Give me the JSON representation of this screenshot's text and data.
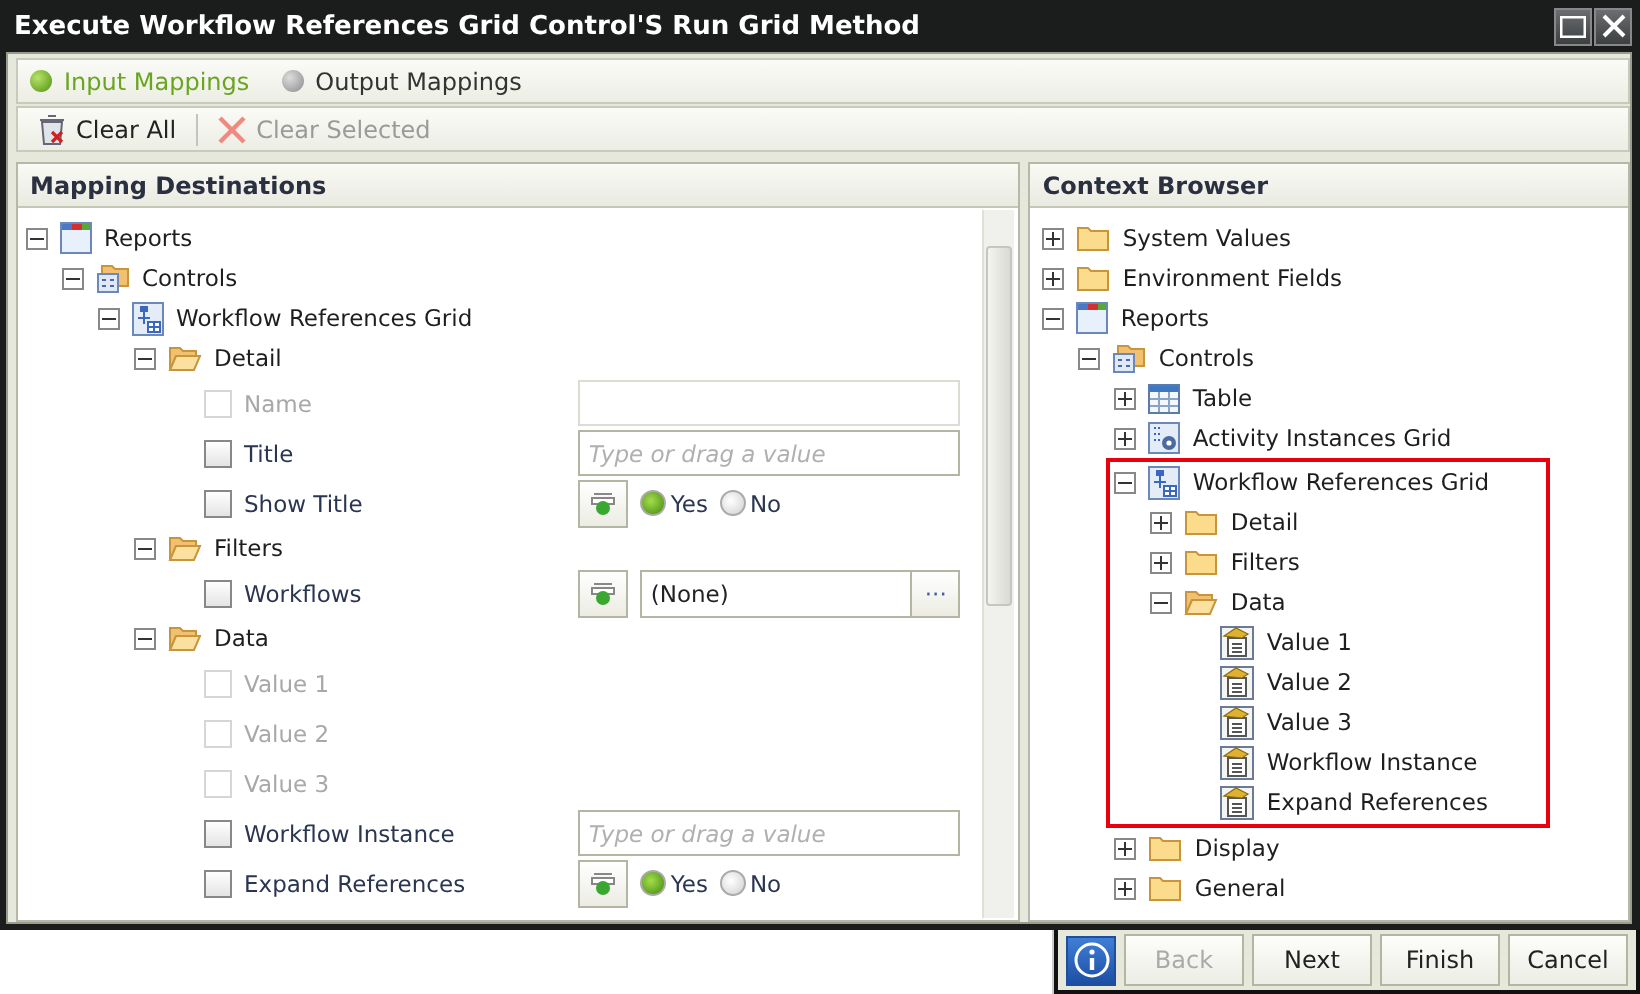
{
  "window": {
    "title": "Execute Workflow References Grid Control'S Run Grid Method"
  },
  "tabs": [
    {
      "label": "Input Mappings",
      "selected": true
    },
    {
      "label": "Output Mappings",
      "selected": false
    }
  ],
  "toolbar": [
    {
      "kind": "clear-all",
      "label": "Clear All",
      "disabled": false
    },
    {
      "kind": "clear-selected",
      "label": "Clear Selected",
      "disabled": true
    }
  ],
  "mapping_destinations": {
    "title": "Mapping Destinations",
    "tree": [
      {
        "label": "Reports",
        "kind": "report",
        "expanded": true,
        "children": [
          {
            "label": "Controls",
            "kind": "controls",
            "expanded": true,
            "children": [
              {
                "label": "Workflow References Grid",
                "kind": "grid",
                "expanded": true,
                "children": [
                  {
                    "label": "Detail",
                    "kind": "folder-open",
                    "expanded": true,
                    "fields": [
                      {
                        "label": "Name",
                        "disabled": true,
                        "checked": false,
                        "input": {
                          "kind": "text"
                        }
                      },
                      {
                        "label": "Title",
                        "disabled": false,
                        "checked": false,
                        "input": {
                          "kind": "text",
                          "placeholder": "Type or drag a value"
                        }
                      },
                      {
                        "label": "Show Title",
                        "disabled": false,
                        "checked": false,
                        "input": {
                          "kind": "boolean",
                          "options": [
                            {
                              "label": "Yes",
                              "selected": true
                            },
                            {
                              "label": "No",
                              "selected": false
                            }
                          ]
                        }
                      }
                    ]
                  },
                  {
                    "label": "Filters",
                    "kind": "folder-open",
                    "expanded": true,
                    "fields": [
                      {
                        "label": "Workflows",
                        "disabled": false,
                        "checked": false,
                        "input": {
                          "kind": "select",
                          "value": "(None)",
                          "button": "···"
                        }
                      }
                    ]
                  },
                  {
                    "label": "Data",
                    "kind": "folder-open",
                    "expanded": true,
                    "fields": [
                      {
                        "label": "Value 1",
                        "disabled": true,
                        "checked": false
                      },
                      {
                        "label": "Value 2",
                        "disabled": true,
                        "checked": false
                      },
                      {
                        "label": "Value 3",
                        "disabled": true,
                        "checked": false
                      },
                      {
                        "label": "Workflow Instance",
                        "disabled": false,
                        "checked": false,
                        "input": {
                          "kind": "text",
                          "placeholder": "Type or drag a value"
                        }
                      },
                      {
                        "label": "Expand References",
                        "disabled": false,
                        "checked": false,
                        "input": {
                          "kind": "boolean",
                          "options": [
                            {
                              "label": "Yes",
                              "selected": true
                            },
                            {
                              "label": "No",
                              "selected": false
                            }
                          ]
                        }
                      }
                    ]
                  }
                ]
              }
            ]
          }
        ]
      }
    ]
  },
  "context_browser": {
    "title": "Context Browser",
    "tree": [
      {
        "label": "System Values",
        "kind": "folder",
        "expanded": false
      },
      {
        "label": "Environment Fields",
        "kind": "folder",
        "expanded": false
      },
      {
        "label": "Reports",
        "kind": "report",
        "expanded": true,
        "children": [
          {
            "label": "Controls",
            "kind": "controls",
            "expanded": true,
            "children": [
              {
                "label": "Table",
                "kind": "table",
                "expanded": false
              },
              {
                "label": "Activity Instances Grid",
                "kind": "activity-grid",
                "expanded": false
              },
              {
                "label": "Workflow References Grid",
                "kind": "grid",
                "expanded": true,
                "highlighted": true,
                "children": [
                  {
                    "label": "Detail",
                    "kind": "folder",
                    "expanded": false
                  },
                  {
                    "label": "Filters",
                    "kind": "folder",
                    "expanded": false
                  },
                  {
                    "label": "Data",
                    "kind": "folder-open",
                    "expanded": true,
                    "children": [
                      {
                        "label": "Value 1",
                        "kind": "field"
                      },
                      {
                        "label": "Value 2",
                        "kind": "field"
                      },
                      {
                        "label": "Value 3",
                        "kind": "field"
                      },
                      {
                        "label": "Workflow Instance",
                        "kind": "field"
                      },
                      {
                        "label": "Expand References",
                        "kind": "field"
                      }
                    ]
                  }
                ]
              },
              {
                "label": "Display",
                "kind": "folder",
                "expanded": false
              },
              {
                "label": "General",
                "kind": "folder",
                "expanded": false
              }
            ]
          }
        ]
      }
    ]
  },
  "footer": [
    {
      "label": "Back",
      "disabled": true
    },
    {
      "label": "Next",
      "disabled": false
    },
    {
      "label": "Finish",
      "disabled": false
    },
    {
      "label": "Cancel",
      "disabled": false
    }
  ]
}
